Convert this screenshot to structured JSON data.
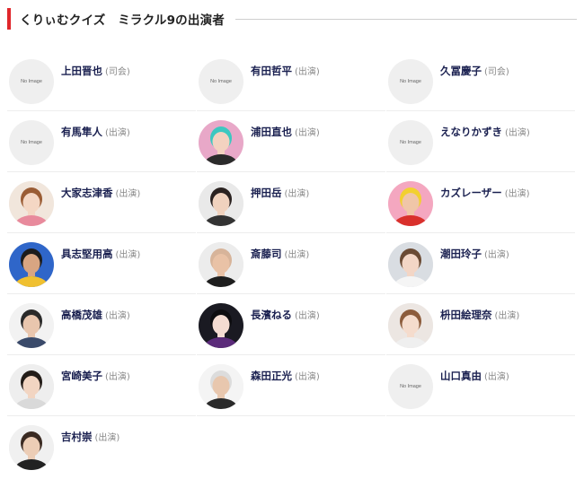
{
  "section": {
    "title": "くりぃむクイズ　ミラクル9の出演者"
  },
  "no_image_text": "No Image",
  "cast": [
    {
      "name": "上田晋也",
      "role": "(司会)",
      "photo": false
    },
    {
      "name": "有田哲平",
      "role": "(出演)",
      "photo": false
    },
    {
      "name": "久冨慶子",
      "role": "(司会)",
      "photo": false
    },
    {
      "name": "有馬隼人",
      "role": "(出演)",
      "photo": false
    },
    {
      "name": "浦田直也",
      "role": "(出演)",
      "photo": true,
      "bg": "#e8a8c8",
      "hair": "#3cc8c0",
      "skin": "#f3d2c0",
      "cloth": "#2b2b2b"
    },
    {
      "name": "えなりかずき",
      "role": "(出演)",
      "photo": false
    },
    {
      "name": "大家志津香",
      "role": "(出演)",
      "photo": true,
      "bg": "#f1e6dc",
      "hair": "#9a5c34",
      "skin": "#f4d7c4",
      "cloth": "#e88a9c"
    },
    {
      "name": "押田岳",
      "role": "(出演)",
      "photo": true,
      "bg": "#e9e9e9",
      "hair": "#2a2220",
      "skin": "#f0d2be",
      "cloth": "#333333"
    },
    {
      "name": "カズレーザー",
      "role": "(出演)",
      "photo": true,
      "bg": "#f4a7c0",
      "hair": "#f2d030",
      "skin": "#f0c6a8",
      "cloth": "#d9302c"
    },
    {
      "name": "具志堅用高",
      "role": "(出演)",
      "photo": true,
      "bg": "#2f66c9",
      "hair": "#1c1c1c",
      "skin": "#d8a582",
      "cloth": "#f0c030"
    },
    {
      "name": "斎藤司",
      "role": "(出演)",
      "photo": true,
      "bg": "#ececec",
      "hair": "#d7b49a",
      "skin": "#e9c2a6",
      "cloth": "#1e1e1e"
    },
    {
      "name": "潮田玲子",
      "role": "(出演)",
      "photo": true,
      "bg": "#d9dde2",
      "hair": "#6a4a34",
      "skin": "#f3d6c6",
      "cloth": "#f5f5f5"
    },
    {
      "name": "高橋茂雄",
      "role": "(出演)",
      "photo": true,
      "bg": "#f2f2f2",
      "hair": "#2a2a2a",
      "skin": "#e9c6ae",
      "cloth": "#3a4a6a"
    },
    {
      "name": "長濱ねる",
      "role": "(出演)",
      "photo": true,
      "bg": "#1a1a22",
      "hair": "#0d0d10",
      "skin": "#f4dcd2",
      "cloth": "#5b2b7a"
    },
    {
      "name": "枡田絵理奈",
      "role": "(出演)",
      "photo": true,
      "bg": "#ece6e2",
      "hair": "#8c5c3c",
      "skin": "#f5dccd",
      "cloth": "#efefef"
    },
    {
      "name": "宮崎美子",
      "role": "(出演)",
      "photo": true,
      "bg": "#eeeeee",
      "hair": "#231c18",
      "skin": "#f2d5c2",
      "cloth": "#d9d9d9"
    },
    {
      "name": "森田正光",
      "role": "(出演)",
      "photo": true,
      "bg": "#f4f4f4",
      "hair": "#dcdcdc",
      "skin": "#e8c7ae",
      "cloth": "#2a2a2a"
    },
    {
      "name": "山口真由",
      "role": "(出演)",
      "photo": false
    },
    {
      "name": "吉村崇",
      "role": "(出演)",
      "photo": true,
      "bg": "#f0f0f0",
      "hair": "#3a2a22",
      "skin": "#eccdb6",
      "cloth": "#222222"
    }
  ]
}
